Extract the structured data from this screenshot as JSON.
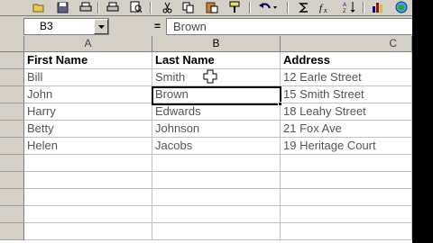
{
  "toolbar": {
    "buttons": [
      {
        "name": "open-icon"
      },
      {
        "name": "save-icon"
      },
      {
        "name": "print-icon"
      },
      {
        "name": "print-preview-icon"
      },
      {
        "name": "cut-icon"
      },
      {
        "name": "copy-icon"
      },
      {
        "name": "paste-icon"
      },
      {
        "name": "format-painter-icon"
      },
      {
        "name": "undo-icon"
      },
      {
        "name": "autosum-icon"
      },
      {
        "name": "function-icon"
      },
      {
        "name": "sort-ascending-icon"
      },
      {
        "name": "chart-wizard-icon"
      }
    ]
  },
  "formula_bar": {
    "name_box": "B3",
    "equals": "=",
    "value": "Brown"
  },
  "columns": [
    "A",
    "B",
    "C"
  ],
  "rows": [
    [
      "First Name",
      "Last Name",
      "Address"
    ],
    [
      "Bill",
      "Smith",
      "12 Earle Street"
    ],
    [
      "John",
      "Brown",
      "15 Smith Street"
    ],
    [
      "Harry",
      "Edwards",
      "18 Leahy Street"
    ],
    [
      "Betty",
      "Johnson",
      "21 Fox Ave"
    ],
    [
      "Helen",
      "Jacobs",
      "19 Heritage Court"
    ],
    [
      "",
      "",
      ""
    ],
    [
      "",
      "",
      ""
    ],
    [
      "",
      "",
      ""
    ],
    [
      "",
      "",
      ""
    ],
    [
      "",
      "",
      ""
    ]
  ],
  "selected_cell": "B3",
  "colors": {
    "chrome": "#d4d0c8",
    "gridline": "#c0c0c0",
    "cell_text": "#555555"
  }
}
